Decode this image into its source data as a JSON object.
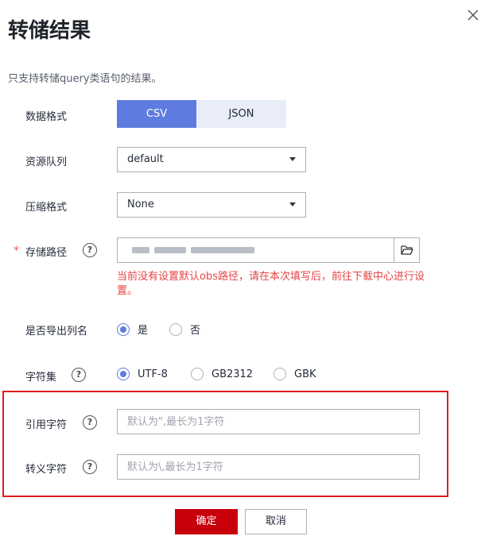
{
  "dialog": {
    "title": "转储结果",
    "description": "只支持转储query类语句的结果。"
  },
  "form": {
    "data_format": {
      "label": "数据格式",
      "options": [
        "CSV",
        "JSON"
      ],
      "selected": "CSV"
    },
    "queue": {
      "label": "资源队列",
      "value": "default"
    },
    "compression": {
      "label": "压缩格式",
      "value": "None"
    },
    "storage_path": {
      "label": "存储路径",
      "required_mark": "*",
      "error": "当前没有设置默认obs路径，请在本次填写后，前往下载中心进行设置。"
    },
    "export_column_names": {
      "label": "是否导出列名",
      "options": [
        "是",
        "否"
      ],
      "selected": "是"
    },
    "charset": {
      "label": "字符集",
      "options": [
        "UTF-8",
        "GB2312",
        "GBK"
      ],
      "selected": "UTF-8"
    },
    "quote_char": {
      "label": "引用字符",
      "placeholder": "默认为\",最长为1字符"
    },
    "escape_char": {
      "label": "转义字符",
      "placeholder": "默认为\\,最长为1字符"
    },
    "help_glyph": "?"
  },
  "footer": {
    "confirm": "确定",
    "cancel": "取消"
  },
  "icons": [
    "close-icon",
    "help-icon",
    "folder-icon",
    "dropdown-arrow-icon"
  ],
  "colors": {
    "accent": "#5e7ce0",
    "primary_button": "#c7000b",
    "error": "#e54545",
    "highlight_box": "#e31b1b"
  }
}
